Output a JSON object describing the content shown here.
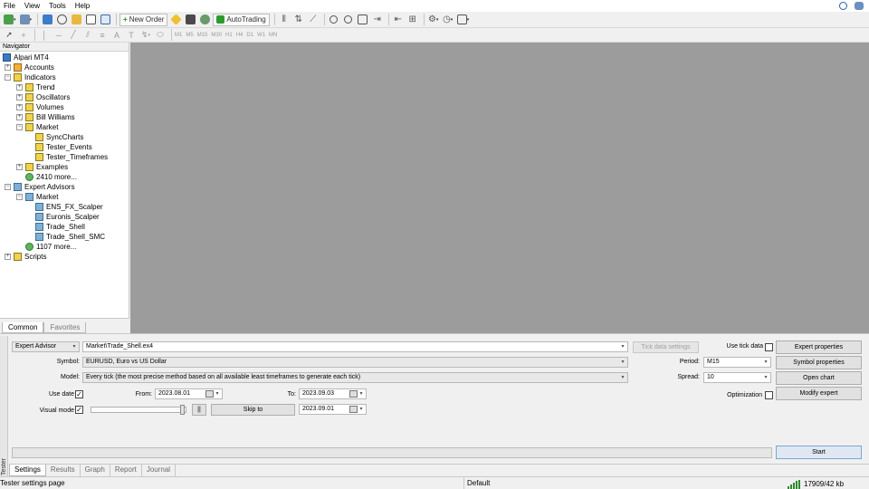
{
  "menu": [
    "File",
    "View",
    "Tools",
    "Help"
  ],
  "toolbar": {
    "new_order_label": "New Order",
    "autotrading_label": "AutoTrading",
    "timeframes": [
      "M1",
      "M5",
      "M15",
      "M30",
      "H1",
      "H4",
      "D1",
      "W1",
      "MN"
    ]
  },
  "navigator": {
    "title": "Navigator",
    "items": [
      {
        "label": "Alpari MT4",
        "level": 0,
        "expander": "",
        "icon": "terminal-icon"
      },
      {
        "label": "Accounts",
        "level": 1,
        "expander": "+",
        "icon": "accounts-icon"
      },
      {
        "label": "Indicators",
        "level": 1,
        "expander": "−",
        "icon": "indicator-folder-icon"
      },
      {
        "label": "Trend",
        "level": 2,
        "expander": "+",
        "icon": "indicator-folder-icon"
      },
      {
        "label": "Oscillators",
        "level": 2,
        "expander": "+",
        "icon": "indicator-folder-icon"
      },
      {
        "label": "Volumes",
        "level": 2,
        "expander": "+",
        "icon": "indicator-folder-icon"
      },
      {
        "label": "Bill Williams",
        "level": 2,
        "expander": "+",
        "icon": "indicator-folder-icon"
      },
      {
        "label": "Market",
        "level": 2,
        "expander": "−",
        "icon": "indicator-folder-icon"
      },
      {
        "label": "SyncCharts",
        "level": 3,
        "expander": "",
        "icon": "indicator-icon"
      },
      {
        "label": "Tester_Events",
        "level": 3,
        "expander": "",
        "icon": "indicator-icon"
      },
      {
        "label": "Tester_Timeframes",
        "level": 3,
        "expander": "",
        "icon": "indicator-icon"
      },
      {
        "label": "Examples",
        "level": 2,
        "expander": "+",
        "icon": "indicator-folder-icon"
      },
      {
        "label": "2410 more...",
        "level": 2,
        "expander": "",
        "icon": "globe-icon"
      },
      {
        "label": "Expert Advisors",
        "level": 1,
        "expander": "−",
        "icon": "expert-folder-icon"
      },
      {
        "label": "Market",
        "level": 2,
        "expander": "−",
        "icon": "expert-folder-icon"
      },
      {
        "label": "ENS_FX_Scalper",
        "level": 3,
        "expander": "",
        "icon": "expert-icon"
      },
      {
        "label": "Euronis_Scalper",
        "level": 3,
        "expander": "",
        "icon": "expert-icon"
      },
      {
        "label": "Trade_Shell",
        "level": 3,
        "expander": "",
        "icon": "expert-icon"
      },
      {
        "label": "Trade_Shell_SMC",
        "level": 3,
        "expander": "",
        "icon": "expert-icon"
      },
      {
        "label": "1107 more...",
        "level": 2,
        "expander": "",
        "icon": "globe-icon"
      },
      {
        "label": "Scripts",
        "level": 1,
        "expander": "+",
        "icon": "scripts-folder-icon"
      }
    ],
    "tabs": [
      "Common",
      "Favorites"
    ]
  },
  "tester": {
    "side_label": "Tester",
    "type_select": "Expert Advisor",
    "expert_file": "Market\\Trade_Shell.ex4",
    "tick_data_settings": "Tick data settings",
    "use_tick_data_label": "Use tick data",
    "symbol_label": "Symbol:",
    "symbol_value": "EURUSD, Euro vs US Dollar",
    "model_label": "Model:",
    "model_value": "Every tick (the most precise method based on all available least timeframes to generate each tick)",
    "use_date_label": "Use date",
    "from_label": "From:",
    "from_value": "2023.08.01",
    "to_label": "To:",
    "to_value": "2023.09.03",
    "visual_mode_label": "Visual mode",
    "pause_label": "||",
    "skip_to_label": "Skip to",
    "skip_to_value": "2023.09.01",
    "period_label": "Period:",
    "period_value": "M15",
    "spread_label": "Spread:",
    "spread_value": "10",
    "optimization_label": "Optimization",
    "expert_properties": "Expert properties",
    "symbol_properties": "Symbol properties",
    "open_chart": "Open chart",
    "modify_expert": "Modify expert",
    "start": "Start",
    "tabs": [
      "Settings",
      "Results",
      "Graph",
      "Report",
      "Journal"
    ]
  },
  "status": {
    "left": "Tester settings page",
    "profile": "Default",
    "traffic": "17909/42 kb"
  }
}
